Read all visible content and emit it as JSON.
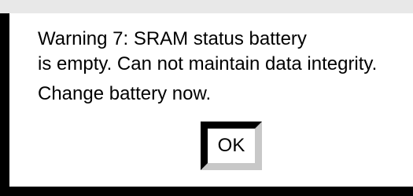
{
  "dialog": {
    "message_lines": [
      "Warning 7: SRAM status battery",
      "is empty. Can not maintain data integrity.",
      "Change battery now."
    ],
    "ok_label": "OK"
  },
  "colors": {
    "frame": "#000000",
    "background": "#ffffff",
    "topbar": "#e8e8e8",
    "button_shadow": "#c8c8c8"
  }
}
